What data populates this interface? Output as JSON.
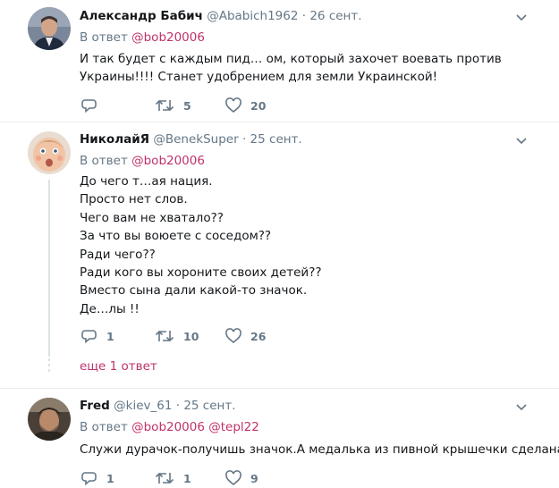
{
  "tweets": [
    {
      "name": "Александр Бабич",
      "handle": "@Ababich1962",
      "separator": "·",
      "time": "26 сент.",
      "reply_prefix": "В ответ",
      "mentions": [
        "@bob20006"
      ],
      "lines": [
        "И так будет с каждым пид… ом, который захочет воевать против",
        "Украины!!!! Станет удобрением для земли Украинской!"
      ],
      "reply_count": "",
      "retweet_count": "5",
      "like_count": "20"
    },
    {
      "name": "НиколайЯ",
      "handle": "@BenekSuper",
      "separator": "·",
      "time": "25 сент.",
      "reply_prefix": "В ответ",
      "mentions": [
        "@bob20006"
      ],
      "lines": [
        "До чего т…ая нация.",
        "Просто нет слов.",
        "Чего вам не хватало??",
        "За что вы воюете с соседом??",
        "Ради чего??",
        "Ради кого вы хороните своих детей??",
        "Вместо сына дали какой-то значок.",
        "Де…лы !!"
      ],
      "reply_count": "1",
      "retweet_count": "10",
      "like_count": "26",
      "more_replies": "еще 1 ответ"
    },
    {
      "name": "Fred",
      "handle": "@kiev_61",
      "separator": "·",
      "time": "25 сент.",
      "reply_prefix": "В ответ",
      "mentions": [
        "@bob20006",
        "@tepl22"
      ],
      "lines": [
        "Служи дурачок-получишь значок.А медалька из пивной крышечки сделана?"
      ],
      "reply_count": "1",
      "retweet_count": "1",
      "like_count": "9"
    }
  ],
  "icons": {
    "reply": "reply-icon",
    "retweet": "retweet-icon",
    "like": "heart-icon",
    "menu": "chevron-down-icon"
  },
  "colors": {
    "mention": "#c0326b",
    "muted": "#657786",
    "text": "#14171a",
    "divider": "#e6ecf0"
  }
}
